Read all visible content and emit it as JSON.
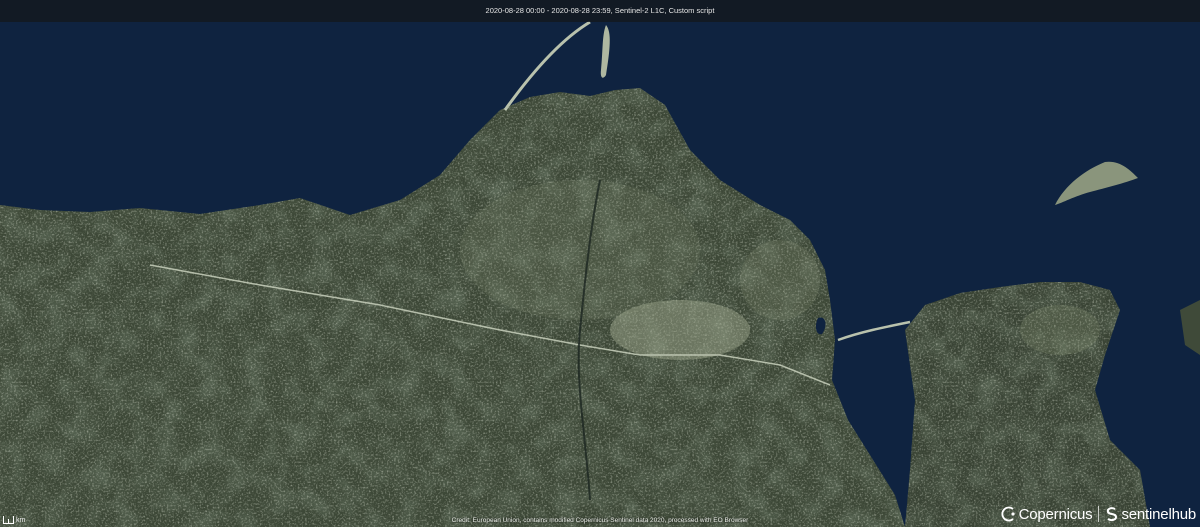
{
  "header": {
    "title": "2020-08-28 00:00 - 2020-08-28 23:59, Sentinel-2 L1C, Custom script"
  },
  "footer": {
    "credit": "Credit: European Union, contains modified Copernicus Sentinel data 2020, processed with EO Browser",
    "scale_label": "km"
  },
  "logos": {
    "left": "Copernicus",
    "right": "sentinelhub",
    "left_icon": "copernicus-logo-icon",
    "right_icon": "sentinelhub-logo-icon"
  },
  "colors": {
    "water": "#0f2340",
    "land": "#3b4636",
    "urban": "#9aa58a",
    "forest": "#2c3529"
  }
}
